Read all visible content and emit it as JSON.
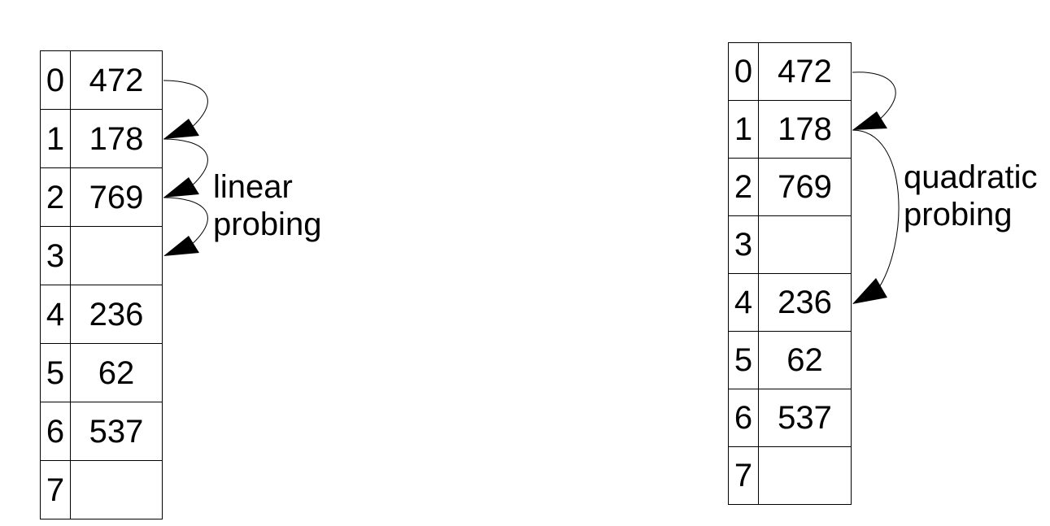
{
  "diagrams": [
    {
      "id": "linear",
      "label_line1": "linear",
      "label_line2": "probing",
      "slots": [
        {
          "index": "0",
          "value": "472"
        },
        {
          "index": "1",
          "value": "178"
        },
        {
          "index": "2",
          "value": "769"
        },
        {
          "index": "3",
          "value": ""
        },
        {
          "index": "4",
          "value": "236"
        },
        {
          "index": "5",
          "value": "62"
        },
        {
          "index": "6",
          "value": "537"
        },
        {
          "index": "7",
          "value": ""
        }
      ],
      "probe_sequence": [
        0,
        1,
        2,
        3
      ]
    },
    {
      "id": "quadratic",
      "label_line1": "quadratic",
      "label_line2": "probing",
      "slots": [
        {
          "index": "0",
          "value": "472"
        },
        {
          "index": "1",
          "value": "178"
        },
        {
          "index": "2",
          "value": "769"
        },
        {
          "index": "3",
          "value": ""
        },
        {
          "index": "4",
          "value": "236"
        },
        {
          "index": "5",
          "value": "62"
        },
        {
          "index": "6",
          "value": "537"
        },
        {
          "index": "7",
          "value": ""
        }
      ],
      "probe_sequence": [
        0,
        1,
        4
      ]
    }
  ],
  "colors": {
    "line": "#000000",
    "background": "#ffffff"
  }
}
